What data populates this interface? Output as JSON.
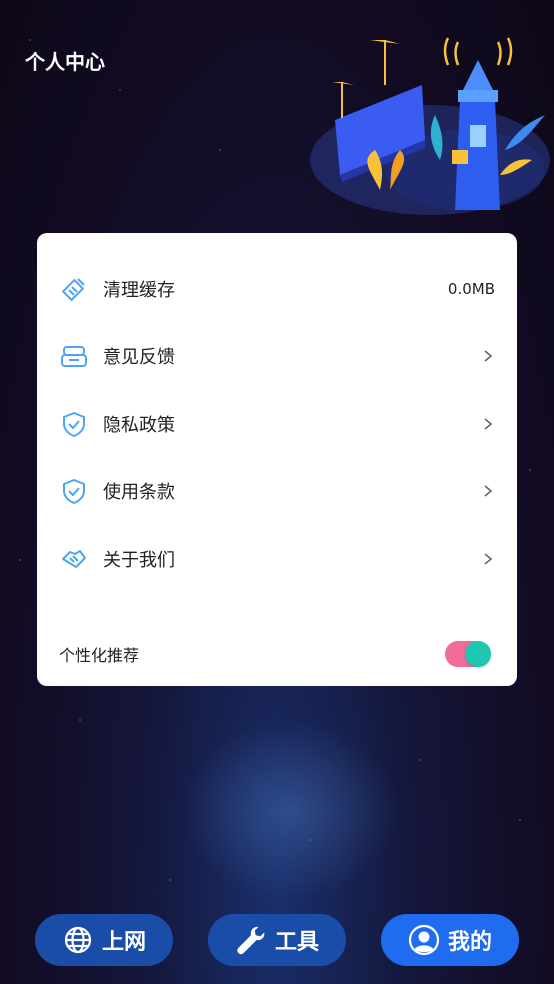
{
  "header": {
    "title": "个人中心"
  },
  "menu": [
    {
      "label": "清理缓存",
      "value": "0.0MB",
      "icon": "broom-icon"
    },
    {
      "label": "意见反馈",
      "icon": "feedback-icon"
    },
    {
      "label": "隐私政策",
      "icon": "shield-check-icon"
    },
    {
      "label": "使用条款",
      "icon": "shield-check-icon"
    },
    {
      "label": "关于我们",
      "icon": "handshake-icon"
    }
  ],
  "personalized": {
    "label": "个性化推荐",
    "enabled": true
  },
  "nav": {
    "web": "上网",
    "tools": "工具",
    "me": "我的"
  },
  "colors": {
    "accent": "#1f6cf0",
    "icon": "#4da3f5",
    "toggle_track": "#f06a9a",
    "toggle_knob": "#1ec8b0"
  }
}
